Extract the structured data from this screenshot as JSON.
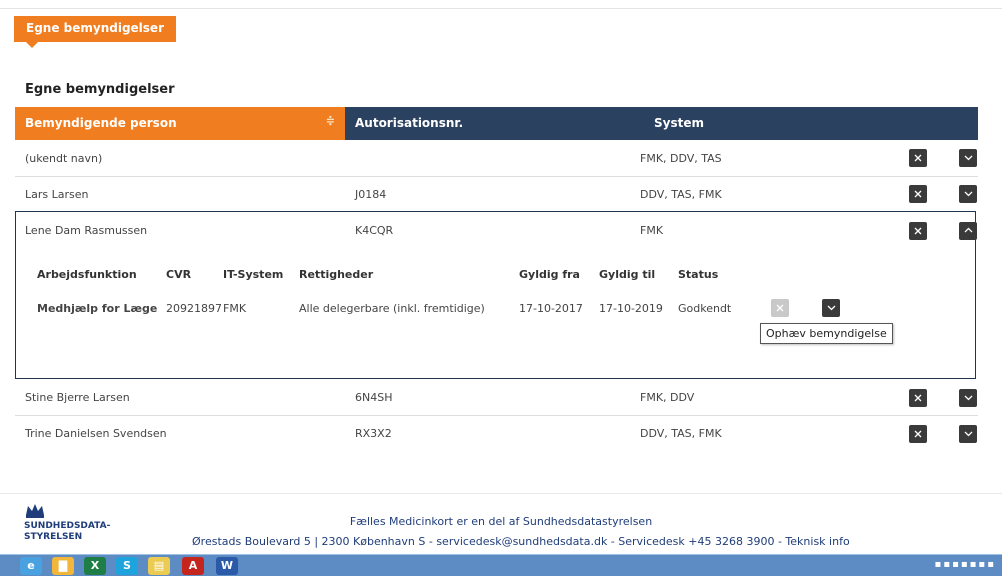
{
  "tab": {
    "label": "Egne bemyndigelser"
  },
  "page_title": "Egne bemyndigelser",
  "table": {
    "headers": {
      "person": "Bemyndigende person",
      "auth": "Autorisationsnr.",
      "system": "System"
    },
    "sort_icon": "≑",
    "rows": [
      {
        "name": "(ukendt navn)",
        "auth": "",
        "system": "FMK, DDV, TAS"
      },
      {
        "name": "Lars Larsen",
        "auth": "J0184",
        "system": "DDV, TAS, FMK"
      },
      {
        "name": "Lene Dam Rasmussen",
        "auth": "K4CQR",
        "system": "FMK"
      },
      {
        "name": "Stine Bjerre Larsen",
        "auth": "6N4SH",
        "system": "FMK, DDV"
      },
      {
        "name": "Trine Danielsen Svendsen",
        "auth": "RX3X2",
        "system": "DDV, TAS, FMK"
      }
    ]
  },
  "detail": {
    "headers": {
      "arbejdsfunktion": "Arbejdsfunktion",
      "cvr": "CVR",
      "itsystem": "IT-System",
      "rettigheder": "Rettigheder",
      "gyldig_fra": "Gyldig fra",
      "gyldig_til": "Gyldig til",
      "status": "Status"
    },
    "row": {
      "arbejdsfunktion": "Medhjælp for Læge",
      "cvr": "20921897",
      "itsystem": "FMK",
      "rettigheder": "Alle delegerbare (inkl. fremtidige)",
      "gyldig_fra": "17-10-2017",
      "gyldig_til": "17-10-2019",
      "status": "Godkendt"
    },
    "tooltip": "Ophæv bemyndigelse"
  },
  "footer": {
    "logo_line1": "SUNDHEDSDATA-",
    "logo_line2": "STYRELSEN",
    "line1": "Fælles Medicinkort er en del af Sundhedsdatastyrelsen",
    "line2": "Ørestads Boulevard 5 | 2300 København S - servicedesk@sundhedsdata.dk - Servicedesk +45 3268 3900 - Teknisk info"
  },
  "colors": {
    "accent": "#f07d1f",
    "header": "#2a4160",
    "button": "#3a3a3a"
  },
  "icons": {
    "remove": "close-icon",
    "expand": "chevron-down-icon",
    "collapse": "chevron-up-icon"
  }
}
